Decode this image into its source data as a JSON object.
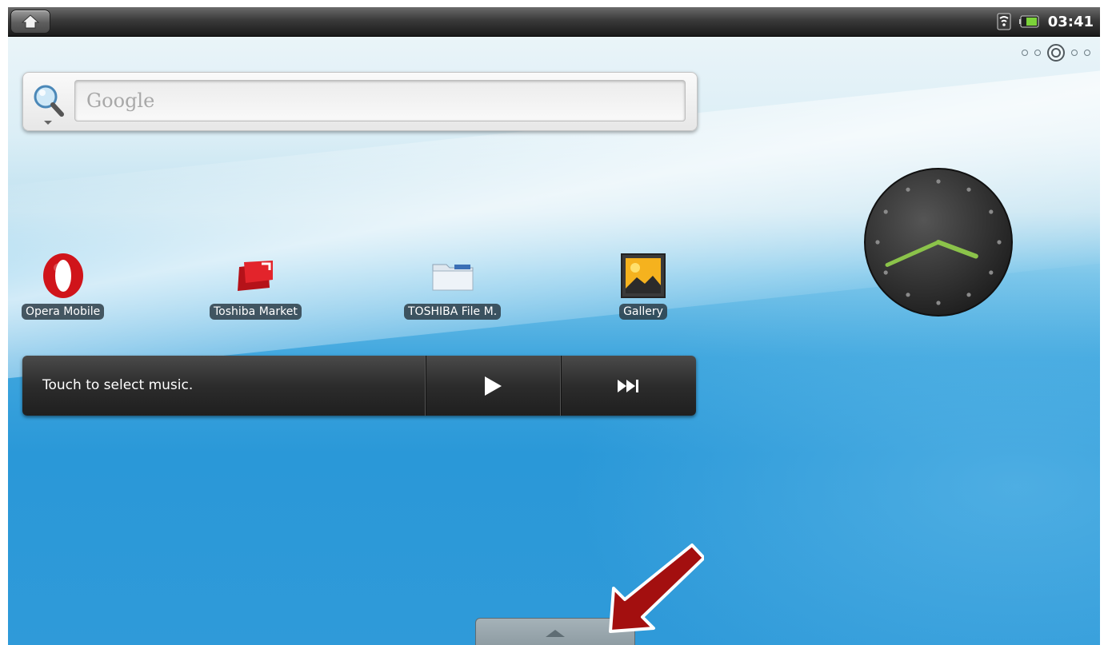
{
  "status_bar": {
    "time": "03:41",
    "home_icon": "home-icon",
    "wifi_icon": "wifi-icon",
    "battery_icon": "battery-icon"
  },
  "pager": {
    "pages": 5,
    "active_page": 3
  },
  "search": {
    "placeholder": "Google",
    "icon": "magnifier-icon"
  },
  "shortcuts": [
    {
      "label": "Opera Mobile",
      "icon": "opera-icon"
    },
    {
      "label": "Toshiba Market",
      "icon": "toshiba-market-icon"
    },
    {
      "label": "TOSHIBA File M.",
      "icon": "folder-icon"
    },
    {
      "label": "Gallery",
      "icon": "gallery-icon"
    }
  ],
  "music": {
    "prompt": "Touch to select music.",
    "play_icon": "play-icon",
    "next_icon": "skip-next-icon"
  },
  "clock": {
    "hour": 3,
    "minute": 41,
    "hand_color": "#8bc34a"
  },
  "drawer": {
    "icon": "drawer-up-arrow-icon"
  },
  "annotation": {
    "color": "#a30f0f",
    "icon": "annotation-arrow-icon"
  }
}
